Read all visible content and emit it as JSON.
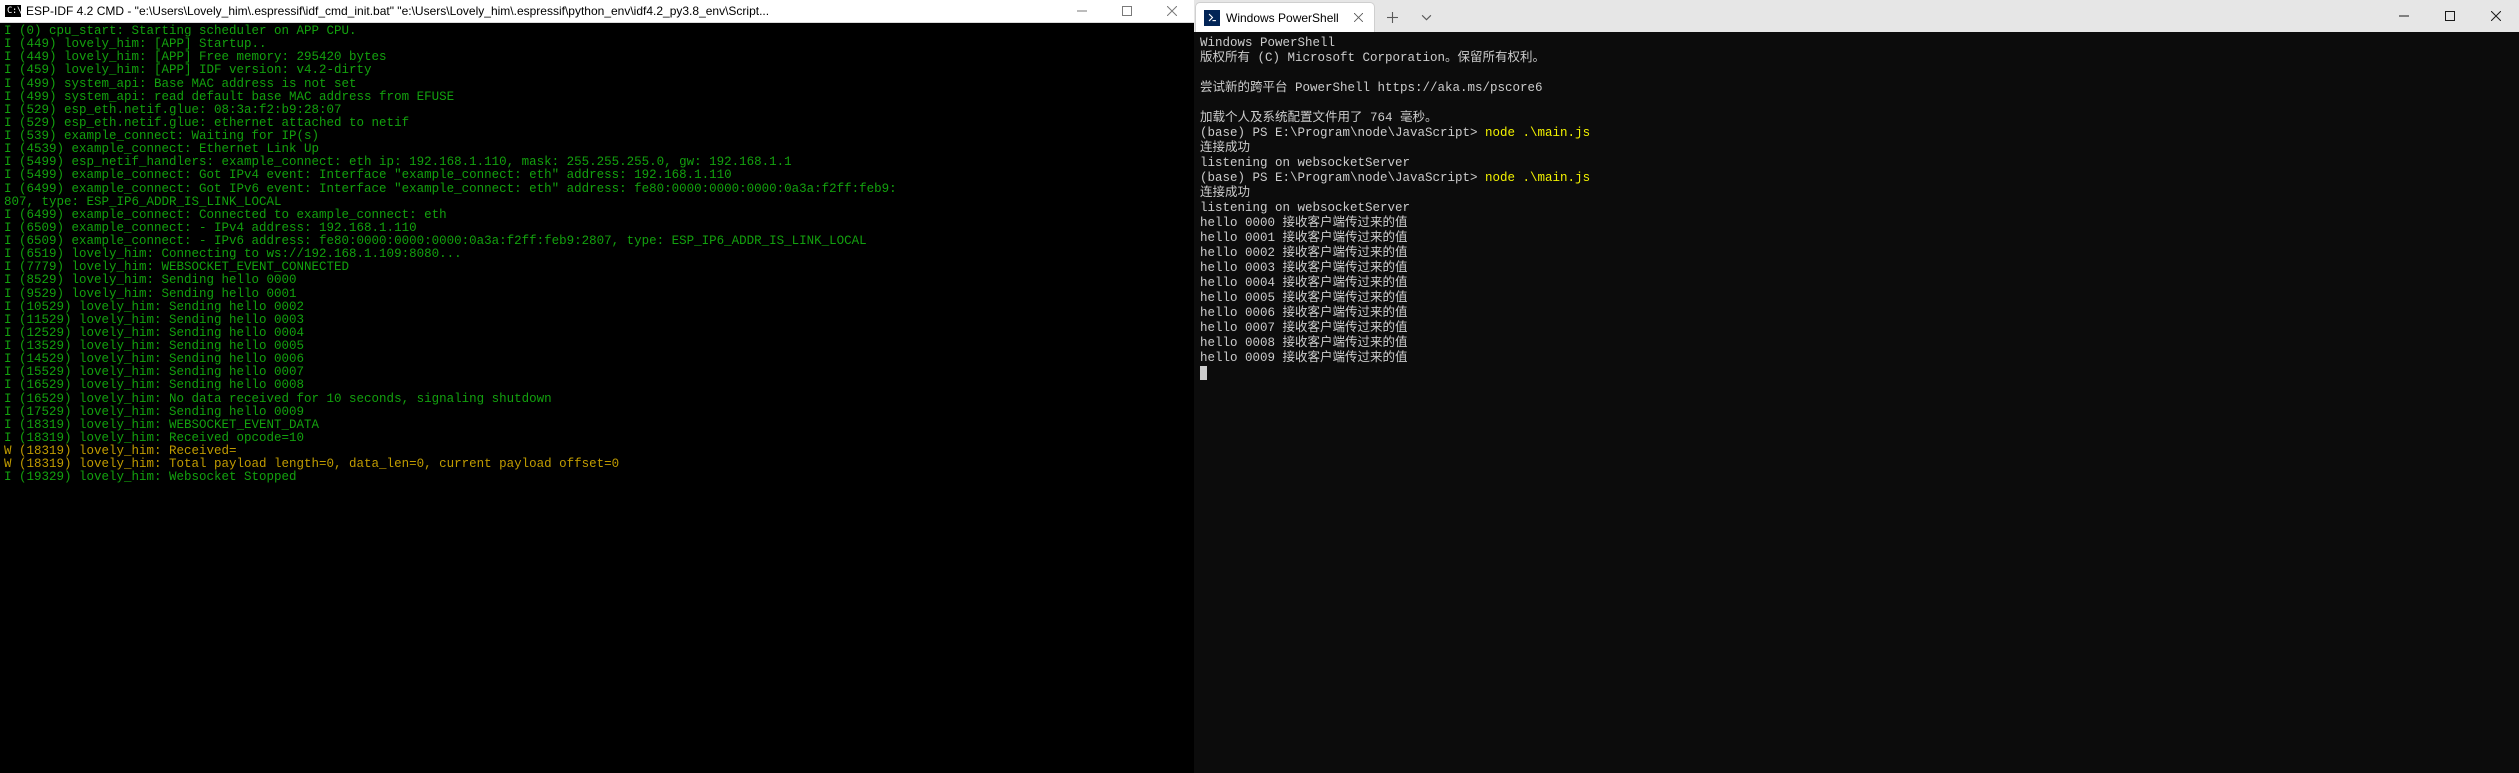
{
  "left": {
    "icon_label": "C:\\.",
    "title": "ESP-IDF 4.2 CMD - \"e:\\Users\\Lovely_him\\.espressif\\idf_cmd_init.bat\"  \"e:\\Users\\Lovely_him\\.espressif\\python_env\\idf4.2_py3.8_env\\Script...",
    "win_min": "minimize",
    "win_max": "maximize",
    "win_close": "close",
    "lines": [
      {
        "c": "g",
        "t": "I (0) cpu_start: Starting scheduler on APP CPU."
      },
      {
        "c": "g",
        "t": "I (449) lovely_him: [APP] Startup.."
      },
      {
        "c": "g",
        "t": "I (449) lovely_him: [APP] Free memory: 295420 bytes"
      },
      {
        "c": "g",
        "t": "I (459) lovely_him: [APP] IDF version: v4.2-dirty"
      },
      {
        "c": "g",
        "t": "I (499) system_api: Base MAC address is not set"
      },
      {
        "c": "g",
        "t": "I (499) system_api: read default base MAC address from EFUSE"
      },
      {
        "c": "g",
        "t": "I (529) esp_eth.netif.glue: 08:3a:f2:b9:28:07"
      },
      {
        "c": "g",
        "t": "I (529) esp_eth.netif.glue: ethernet attached to netif"
      },
      {
        "c": "g",
        "t": "I (539) example_connect: Waiting for IP(s)"
      },
      {
        "c": "g",
        "t": "I (4539) example_connect: Ethernet Link Up"
      },
      {
        "c": "g",
        "t": "I (5499) esp_netif_handlers: example_connect: eth ip: 192.168.1.110, mask: 255.255.255.0, gw: 192.168.1.1"
      },
      {
        "c": "g",
        "t": "I (5499) example_connect: Got IPv4 event: Interface \"example_connect: eth\" address: 192.168.1.110"
      },
      {
        "c": "g",
        "t": "I (6499) example_connect: Got IPv6 event: Interface \"example_connect: eth\" address: fe80:0000:0000:0000:0a3a:f2ff:feb9:"
      },
      {
        "c": "g",
        "t": "807, type: ESP_IP6_ADDR_IS_LINK_LOCAL"
      },
      {
        "c": "g",
        "t": "I (6499) example_connect: Connected to example_connect: eth"
      },
      {
        "c": "g",
        "t": "I (6509) example_connect: - IPv4 address: 192.168.1.110"
      },
      {
        "c": "g",
        "t": "I (6509) example_connect: - IPv6 address: fe80:0000:0000:0000:0a3a:f2ff:feb9:2807, type: ESP_IP6_ADDR_IS_LINK_LOCAL"
      },
      {
        "c": "g",
        "t": "I (6519) lovely_him: Connecting to ws://192.168.1.109:8080..."
      },
      {
        "c": "g",
        "t": "I (7779) lovely_him: WEBSOCKET_EVENT_CONNECTED"
      },
      {
        "c": "g",
        "t": "I (8529) lovely_him: Sending hello 0000"
      },
      {
        "c": "g",
        "t": "I (9529) lovely_him: Sending hello 0001"
      },
      {
        "c": "g",
        "t": "I (10529) lovely_him: Sending hello 0002"
      },
      {
        "c": "g",
        "t": "I (11529) lovely_him: Sending hello 0003"
      },
      {
        "c": "g",
        "t": "I (12529) lovely_him: Sending hello 0004"
      },
      {
        "c": "g",
        "t": "I (13529) lovely_him: Sending hello 0005"
      },
      {
        "c": "g",
        "t": "I (14529) lovely_him: Sending hello 0006"
      },
      {
        "c": "g",
        "t": "I (15529) lovely_him: Sending hello 0007"
      },
      {
        "c": "g",
        "t": "I (16529) lovely_him: Sending hello 0008"
      },
      {
        "c": "g",
        "t": "I (16529) lovely_him: No data received for 10 seconds, signaling shutdown"
      },
      {
        "c": "g",
        "t": "I (17529) lovely_him: Sending hello 0009"
      },
      {
        "c": "g",
        "t": "I (18319) lovely_him: WEBSOCKET_EVENT_DATA"
      },
      {
        "c": "g",
        "t": "I (18319) lovely_him: Received opcode=10"
      },
      {
        "c": "y",
        "t": "W (18319) lovely_him: Received="
      },
      {
        "c": "y",
        "t": "W (18319) lovely_him: Total payload length=0, data_len=0, current payload offset=0"
      },
      {
        "c": "g",
        "t": ""
      },
      {
        "c": "g",
        "t": "I (19329) lovely_him: Websocket Stopped"
      }
    ]
  },
  "right": {
    "tab_title": "Windows PowerShell",
    "tab_add": "+",
    "tab_dropdown": "⌄",
    "win_min": "minimize",
    "win_max": "maximize",
    "win_close": "close",
    "blocks": [
      {
        "type": "line",
        "c": "w",
        "t": "Windows PowerShell"
      },
      {
        "type": "line",
        "c": "w",
        "t": "版权所有 (C) Microsoft Corporation。保留所有权利。"
      },
      {
        "type": "line",
        "c": "w",
        "t": ""
      },
      {
        "type": "line",
        "c": "w",
        "t": "尝试新的跨平台 PowerShell https://aka.ms/pscore6"
      },
      {
        "type": "line",
        "c": "w",
        "t": ""
      },
      {
        "type": "line",
        "c": "w",
        "t": "加载个人及系统配置文件用了 764 毫秒。"
      },
      {
        "type": "prompt",
        "prompt": "(base) PS E:\\Program\\node\\JavaScript> ",
        "cmd": "node .\\main.js"
      },
      {
        "type": "line",
        "c": "w",
        "t": "连接成功"
      },
      {
        "type": "line",
        "c": "w",
        "t": "listening on websocketServer"
      },
      {
        "type": "prompt",
        "prompt": "(base) PS E:\\Program\\node\\JavaScript> ",
        "cmd": "node .\\main.js"
      },
      {
        "type": "line",
        "c": "w",
        "t": "连接成功"
      },
      {
        "type": "line",
        "c": "w",
        "t": "listening on websocketServer"
      },
      {
        "type": "line",
        "c": "w",
        "t": "hello 0000 接收客户端传过来的值"
      },
      {
        "type": "line",
        "c": "w",
        "t": "hello 0001 接收客户端传过来的值"
      },
      {
        "type": "line",
        "c": "w",
        "t": "hello 0002 接收客户端传过来的值"
      },
      {
        "type": "line",
        "c": "w",
        "t": "hello 0003 接收客户端传过来的值"
      },
      {
        "type": "line",
        "c": "w",
        "t": "hello 0004 接收客户端传过来的值"
      },
      {
        "type": "line",
        "c": "w",
        "t": "hello 0005 接收客户端传过来的值"
      },
      {
        "type": "line",
        "c": "w",
        "t": "hello 0006 接收客户端传过来的值"
      },
      {
        "type": "line",
        "c": "w",
        "t": "hello 0007 接收客户端传过来的值"
      },
      {
        "type": "line",
        "c": "w",
        "t": "hello 0008 接收客户端传过来的值"
      },
      {
        "type": "line",
        "c": "w",
        "t": "hello 0009 接收客户端传过来的值"
      }
    ]
  }
}
